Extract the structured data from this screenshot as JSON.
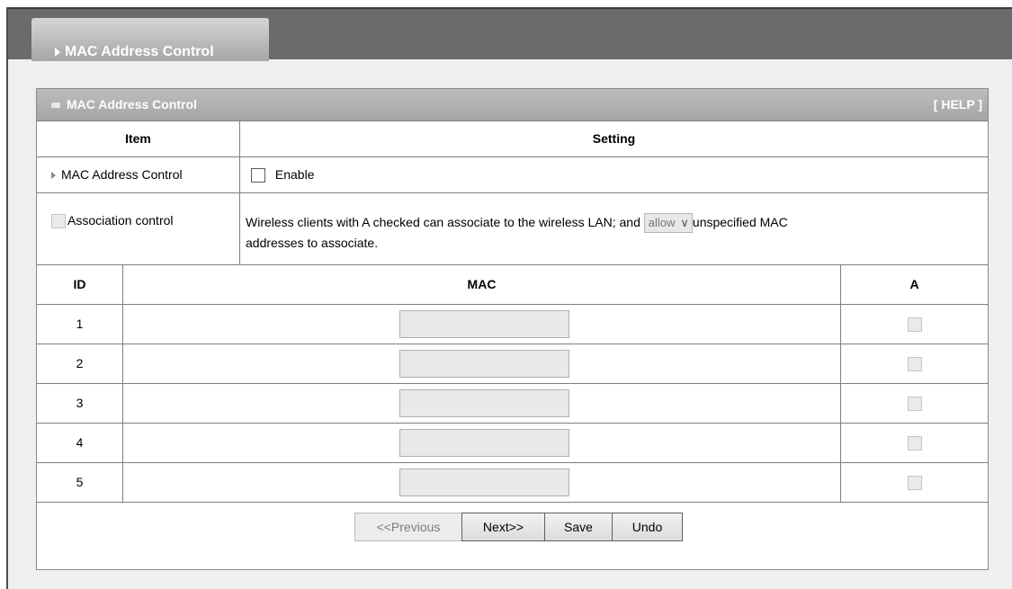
{
  "page_tab": {
    "label": "MAC Address Control"
  },
  "panel": {
    "title": "MAC Address Control",
    "help_label": "[ HELP ]"
  },
  "columns": {
    "item": "Item",
    "setting": "Setting"
  },
  "mac_control": {
    "label": "MAC Address Control",
    "enable_label": "Enable",
    "enabled": false
  },
  "association": {
    "label": "Association control",
    "text_before": "Wireless clients with A checked can associate to the wireless LAN; and",
    "select_value": "allow",
    "text_after": "unspecified MAC",
    "text_line2": "addresses to associate."
  },
  "mac_table": {
    "headers": {
      "id": "ID",
      "mac": "MAC",
      "a": "A"
    },
    "rows": [
      {
        "id": "1",
        "mac": "",
        "checked": false
      },
      {
        "id": "2",
        "mac": "",
        "checked": false
      },
      {
        "id": "3",
        "mac": "",
        "checked": false
      },
      {
        "id": "4",
        "mac": "",
        "checked": false
      },
      {
        "id": "5",
        "mac": "",
        "checked": false
      }
    ]
  },
  "buttons": {
    "previous": "<<Previous",
    "next": "Next>>",
    "save": "Save",
    "undo": "Undo"
  }
}
